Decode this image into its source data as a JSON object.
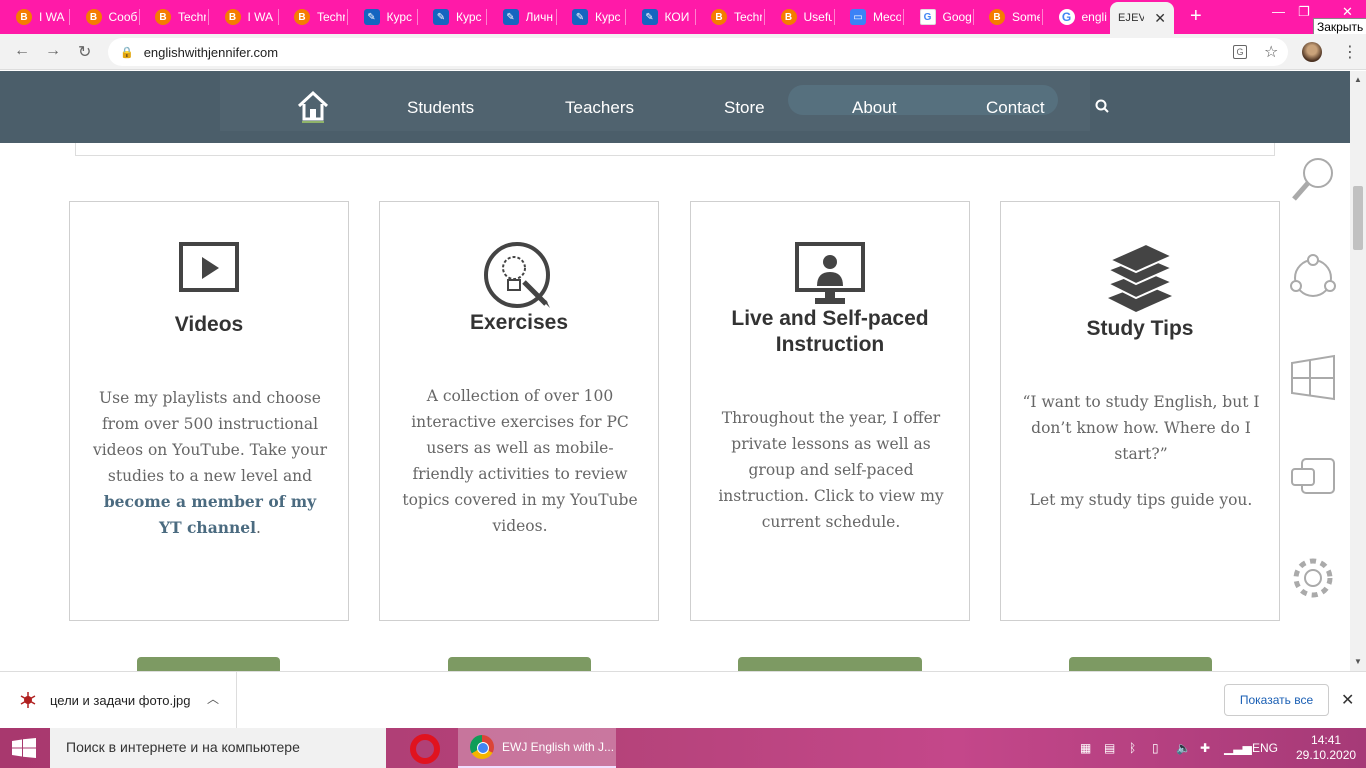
{
  "browser": {
    "tabs": [
      {
        "favicon": "blogger-icon",
        "title": "I WA"
      },
      {
        "favicon": "blogger-icon",
        "title": "Сооб"
      },
      {
        "favicon": "blogger-icon",
        "title": "Techr"
      },
      {
        "favicon": "blogger-icon",
        "title": "I WA"
      },
      {
        "favicon": "blogger-icon",
        "title": "Techr"
      },
      {
        "favicon": "quill-icon",
        "title": "Курс"
      },
      {
        "favicon": "quill-icon",
        "title": "Курс"
      },
      {
        "favicon": "quill-icon",
        "title": "Личн"
      },
      {
        "favicon": "quill-icon",
        "title": "Курс"
      },
      {
        "favicon": "quill-icon",
        "title": "КОИ"
      },
      {
        "favicon": "blogger-icon",
        "title": "Techr"
      },
      {
        "favicon": "blogger-icon",
        "title": "Usefu"
      },
      {
        "favicon": "messages-icon",
        "title": "Meco"
      },
      {
        "favicon": "google-translate-icon",
        "title": "Goog"
      },
      {
        "favicon": "blogger-icon",
        "title": "Some"
      },
      {
        "favicon": "google-icon",
        "title": "engli"
      }
    ],
    "active_tab": {
      "favicon_text": "EJ",
      "title": "EV"
    },
    "tooltip": "Закрыть",
    "url": "englishwithjennifer.com"
  },
  "site": {
    "nav": {
      "items": [
        "Students",
        "Teachers",
        "Store",
        "About",
        "Contact"
      ]
    },
    "cards": [
      {
        "icon": "video-play-icon",
        "title": "Videos",
        "text": "Use my playlists and choose from over 500 instructional videos on YouTube. Take your studies to a new level and ",
        "link": "become a member of my YT channel",
        "text_after": "."
      },
      {
        "icon": "lightbulb-pencil-icon",
        "title": "Exercises",
        "text": "A collection of over 100 interactive exercises for PC users as well as mobile-friendly activities to review topics covered in my YouTube videos."
      },
      {
        "icon": "monitor-teacher-icon",
        "title": "Live and Self-paced Instruction",
        "text": "Throughout the year, I offer private lessons as well as group and self-paced instruction. Click to view my current schedule."
      },
      {
        "icon": "books-icon",
        "title": "Study Tips",
        "text": "“I want to study English, but I don’t know how. Where do I start?”",
        "text2": "Let my study tips guide you."
      }
    ],
    "colors": {
      "nav_bg": "#4b5e6a",
      "button_green": "#7d9a63",
      "link": "#4b6b80"
    }
  },
  "downloads": {
    "file_name": "цели и задачи фото.jpg",
    "show_all": "Показать все"
  },
  "taskbar": {
    "search_placeholder": "Поиск в интернете и на компьютере",
    "chrome_window": "EWJ English with J...",
    "language": "ENG",
    "time": "14:41",
    "date": "29.10.2020"
  }
}
